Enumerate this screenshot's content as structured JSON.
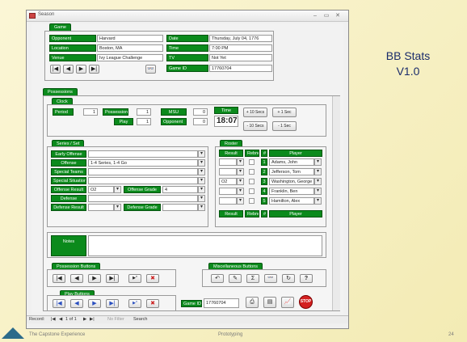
{
  "window": {
    "title": "Season"
  },
  "side_title": {
    "line1": "BB Stats",
    "line2": "V1.0"
  },
  "game": {
    "tab": "Game",
    "opponent_label": "Opponent",
    "opponent": "Harvard",
    "location_label": "Location",
    "location": "Boston, MA",
    "venue_label": "Venue",
    "venue": "Ivy League Challenge",
    "date_label": "Date",
    "date": "Thursday, July 04, 1776",
    "time_label": "Time",
    "time": "7:00 PM",
    "tv_label": "TV",
    "tv": "Not Yet",
    "gameid_label": "Game ID",
    "gameid": "17760704"
  },
  "possessions": {
    "tab": "Possessions"
  },
  "clock": {
    "tab": "Clock",
    "period_label": "Period",
    "period": "1",
    "possession_label": "Possession",
    "possession": "1",
    "play_label": "Play",
    "play": "1",
    "msu_label": "MSU",
    "msu": "0",
    "opponent_label": "Opponent",
    "opponent": "0",
    "time_label": "Time",
    "time": "18:07",
    "plus10": "+ 10 Secs",
    "plus1": "+ 1 Sec",
    "minus10": "- 10 Secs",
    "minus1": "- 1 Sec"
  },
  "series": {
    "tab": "Series / Set",
    "early_offense": "Early Offense",
    "offense_label": "Offense",
    "offense": "1-4 Series, 1-4 Go",
    "special_teams": "Special Teams",
    "special_situations": "Special Situations",
    "offense_result_label": "Offense Result",
    "offense_result": "O2",
    "offense_grade_label": "Offense Grade",
    "offense_grade": "4",
    "defense_label": "Defense",
    "defense_result_label": "Defense Result",
    "defense_grade_label": "Defense Grade"
  },
  "roster": {
    "tab": "Roster",
    "headers": {
      "result": "Result",
      "rebnd": "Rebnd",
      "num": "#",
      "player": "Player"
    },
    "rows": [
      {
        "result": "",
        "num": "1",
        "player": "Adams, John"
      },
      {
        "result": "",
        "num": "2",
        "player": "Jefferson, Tom"
      },
      {
        "result": "O2",
        "num": "3",
        "player": "Washington, George"
      },
      {
        "result": "",
        "num": "4",
        "player": "Franklin, Ben"
      },
      {
        "result": "",
        "num": "5",
        "player": "Hamilton, Alex"
      }
    ]
  },
  "notes": {
    "label": "Notes",
    "value": ""
  },
  "possession_buttons": {
    "tab": "Possession Buttons"
  },
  "misc_buttons": {
    "tab": "Miscellaneous Buttons"
  },
  "play_buttons": {
    "tab": "Play Buttons"
  },
  "bottom": {
    "gameid_label": "Game ID",
    "gameid": "17760704",
    "stop": "STOP"
  },
  "status": {
    "record": "Record:",
    "position": "1 of 1",
    "filter": "No Filter",
    "search": "Search"
  },
  "footer": {
    "left": "The Capstone Experience",
    "center": "Prototyping",
    "page": "24"
  },
  "nav_glyphs": {
    "first": "|◀",
    "prev": "◀",
    "next": "▶",
    "last": "▶|",
    "new": "▶*",
    "delete": "✖"
  },
  "misc_glyphs": {
    "undo": "↶",
    "edit": "✎",
    "sum": "Σ",
    "find": "👓",
    "refresh": "↻",
    "help": "?"
  },
  "play_glyphs": {
    "first": "|◀",
    "prev": "◀",
    "next": "▶",
    "last": "▶|",
    "new": "▶*",
    "delete": "✖"
  },
  "colors": {
    "green": "#0b8a1c",
    "title_blue": "#1a2c6b",
    "stop": "#d42020"
  }
}
